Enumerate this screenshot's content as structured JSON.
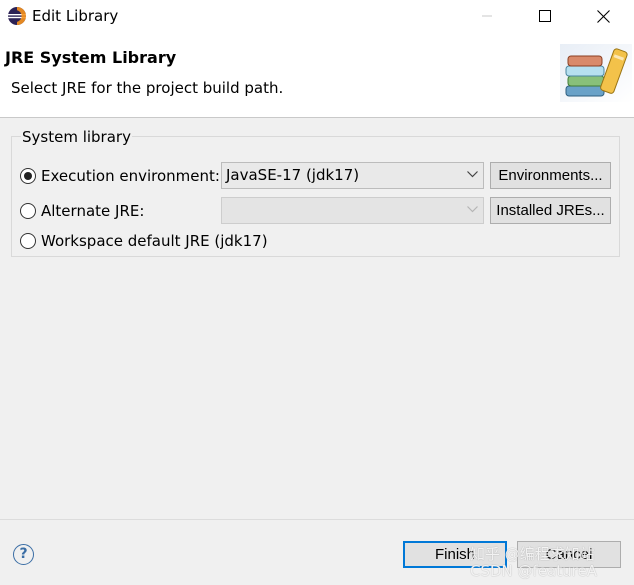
{
  "window": {
    "title": "Edit Library",
    "icon": "eclipse-icon"
  },
  "banner": {
    "title": "JRE System Library",
    "description": "Select JRE for the project build path.",
    "image": "library-books-image"
  },
  "group": {
    "label": "System library",
    "execution_environment": {
      "label": "Execution environment:",
      "selected": true,
      "value": "JavaSE-17 (jdk17)",
      "button": "Environments..."
    },
    "alternate_jre": {
      "label": "Alternate JRE:",
      "selected": false,
      "value": "",
      "enabled": false,
      "button": "Installed JREs..."
    },
    "workspace_default": {
      "label": "Workspace default JRE (jdk17)",
      "selected": false
    }
  },
  "footer": {
    "help": "?",
    "finish": "Finish",
    "cancel": "Cancel",
    "watermark": "知乎 @编程求知站\nCSDN @featureA"
  },
  "colors": {
    "accent": "#0078d7",
    "help": "#3b6ea5"
  }
}
